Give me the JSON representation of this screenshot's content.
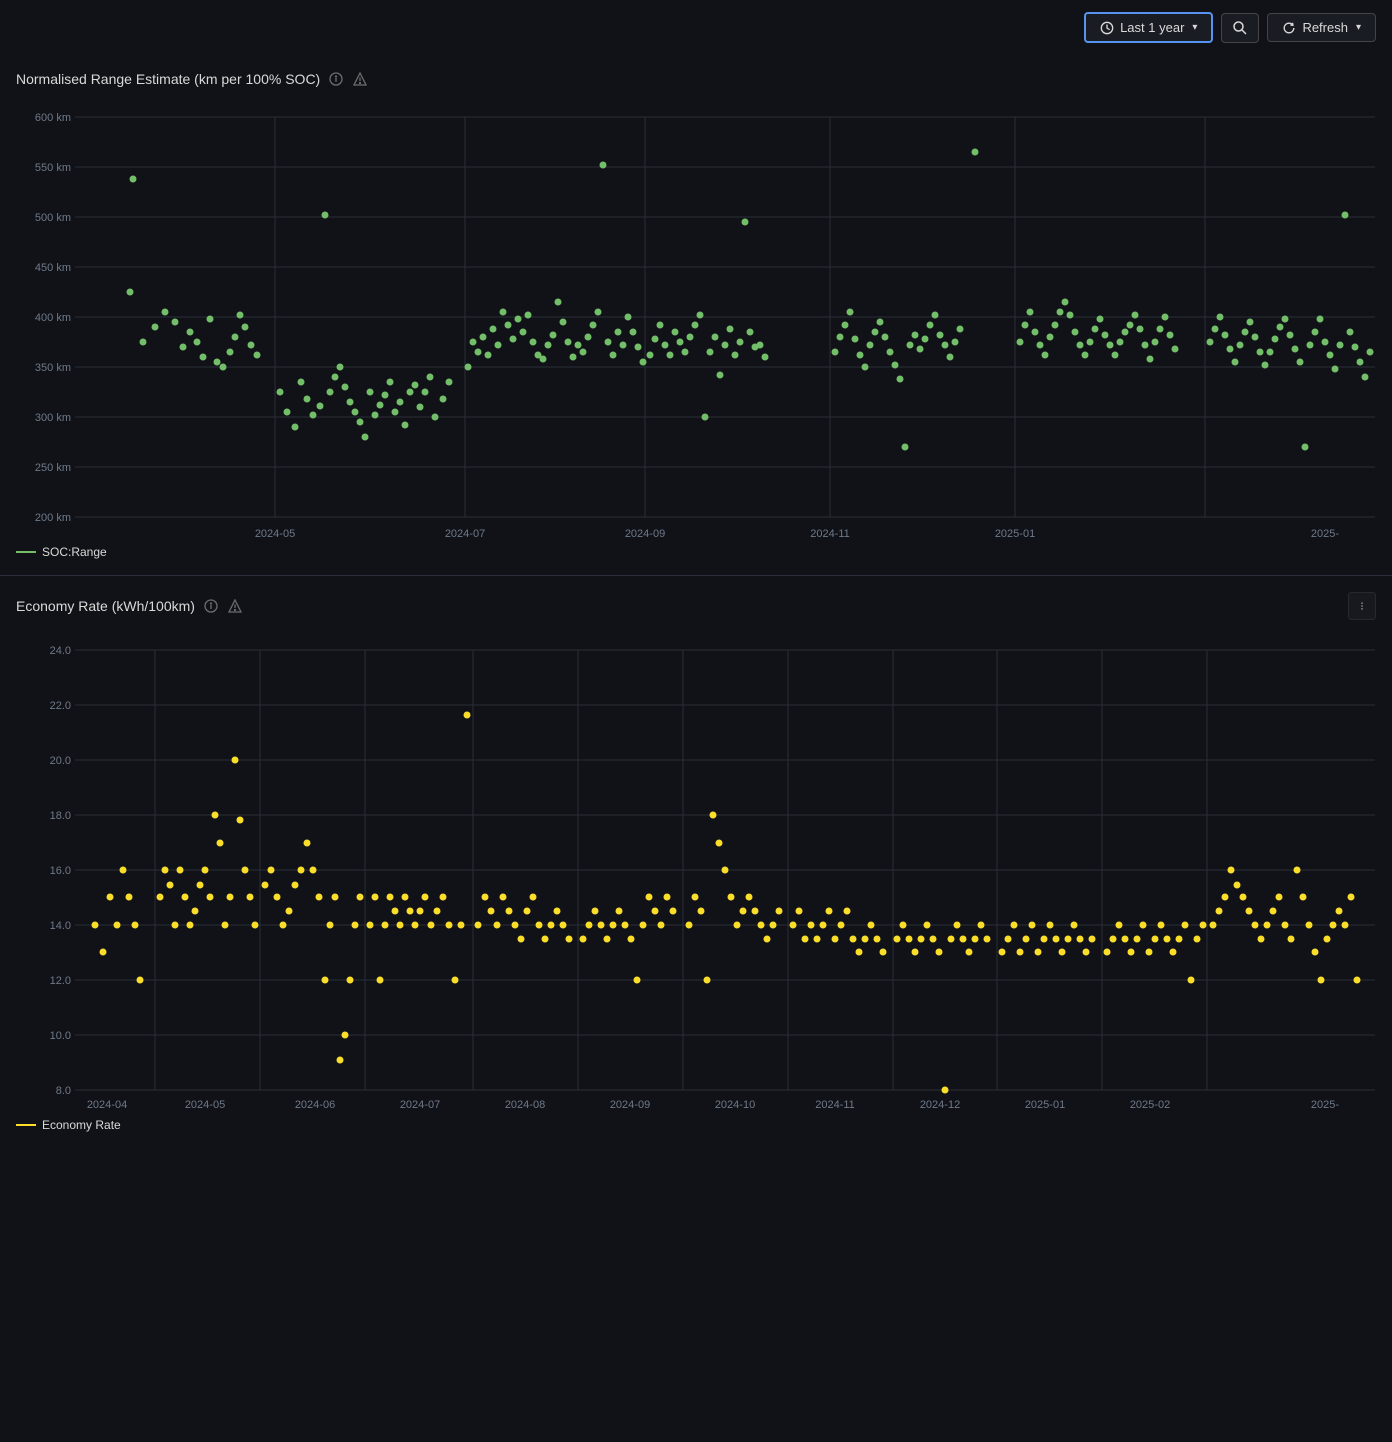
{
  "topbar": {
    "time_button_label": "Last 1 year",
    "search_label": "",
    "refresh_label": "Refresh"
  },
  "chart1": {
    "title": "Normalised Range Estimate (km per 100% SOC)",
    "y_labels": [
      "600 km",
      "550 km",
      "500 km",
      "450 km",
      "400 km",
      "350 km",
      "300 km",
      "250 km",
      "200 km"
    ],
    "x_labels": [
      "2024-05",
      "2024-07",
      "2024-09",
      "2024-11",
      "2025-01",
      "2025-"
    ],
    "legend_label": "SOC:Range",
    "dot_color": "#73bf69"
  },
  "chart2": {
    "title": "Economy Rate (kWh/100km)",
    "y_labels": [
      "24.0",
      "22.0",
      "20.0",
      "18.0",
      "16.0",
      "14.0",
      "12.0",
      "10.0",
      "8.0"
    ],
    "x_labels": [
      "2024-04",
      "2024-05",
      "2024-06",
      "2024-07",
      "2024-08",
      "2024-09",
      "2024-10",
      "2024-11",
      "2024-12",
      "2025-01",
      "2025-02",
      "2025-"
    ],
    "legend_label": "Economy Rate",
    "dot_color": "#fade2a"
  }
}
